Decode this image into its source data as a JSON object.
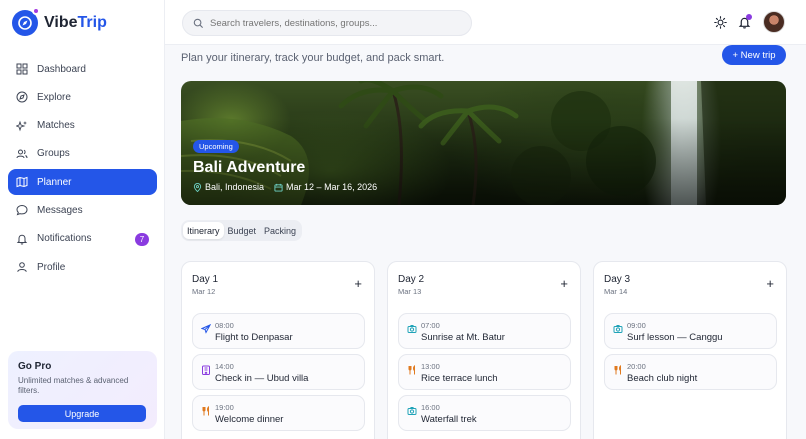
{
  "app": {
    "name_part1": "Vibe",
    "name_part2": "Trip"
  },
  "search": {
    "placeholder": "Search travelers, destinations, groups..."
  },
  "sidebar": {
    "items": [
      {
        "label": "Dashboard",
        "icon": "grid-icon"
      },
      {
        "label": "Explore",
        "icon": "compass-icon"
      },
      {
        "label": "Matches",
        "icon": "sparkle-icon"
      },
      {
        "label": "Groups",
        "icon": "users-icon"
      },
      {
        "label": "Planner",
        "icon": "map-icon",
        "active": true
      },
      {
        "label": "Messages",
        "icon": "chat-icon"
      },
      {
        "label": "Notifications",
        "icon": "bell-icon",
        "badge": "7"
      },
      {
        "label": "Profile",
        "icon": "user-icon"
      }
    ],
    "gopro": {
      "title": "Go Pro",
      "text": "Unlimited matches & advanced filters.",
      "button": "Upgrade"
    }
  },
  "page": {
    "subtitle": "Plan your itinerary, track your budget, and pack smart.",
    "new_trip": "+ New trip"
  },
  "hero": {
    "badge": "Upcoming",
    "title": "Bali Adventure",
    "location": "Bali, Indonesia",
    "dates": "Mar 12 – Mar 16, 2026"
  },
  "tabs": [
    "Itinerary",
    "Budget",
    "Packing"
  ],
  "days": [
    {
      "title": "Day 1",
      "date": "Mar 12",
      "activities": [
        {
          "time": "08:00",
          "title": "Flight to Denpasar",
          "icon": "plane-icon",
          "color": "#2456e8"
        },
        {
          "time": "14:00",
          "title": "Check in — Ubud villa",
          "icon": "hotel-icon",
          "color": "#8a3be0"
        },
        {
          "time": "19:00",
          "title": "Welcome dinner",
          "icon": "utensils-icon",
          "color": "#e07a1f"
        }
      ]
    },
    {
      "title": "Day 2",
      "date": "Mar 13",
      "activities": [
        {
          "time": "07:00",
          "title": "Sunrise at Mt. Batur",
          "icon": "camera-icon",
          "color": "#1fa3b8"
        },
        {
          "time": "13:00",
          "title": "Rice terrace lunch",
          "icon": "utensils-icon",
          "color": "#e07a1f"
        },
        {
          "time": "16:00",
          "title": "Waterfall trek",
          "icon": "camera-icon",
          "color": "#1fa3b8"
        }
      ]
    },
    {
      "title": "Day 3",
      "date": "Mar 14",
      "activities": [
        {
          "time": "09:00",
          "title": "Surf lesson — Canggu",
          "icon": "camera-icon",
          "color": "#1fa3b8"
        },
        {
          "time": "20:00",
          "title": "Beach club night",
          "icon": "utensils-icon",
          "color": "#e07a1f"
        }
      ]
    }
  ],
  "colors": {
    "accent": "#2456e8",
    "purple": "#8a3be0"
  }
}
